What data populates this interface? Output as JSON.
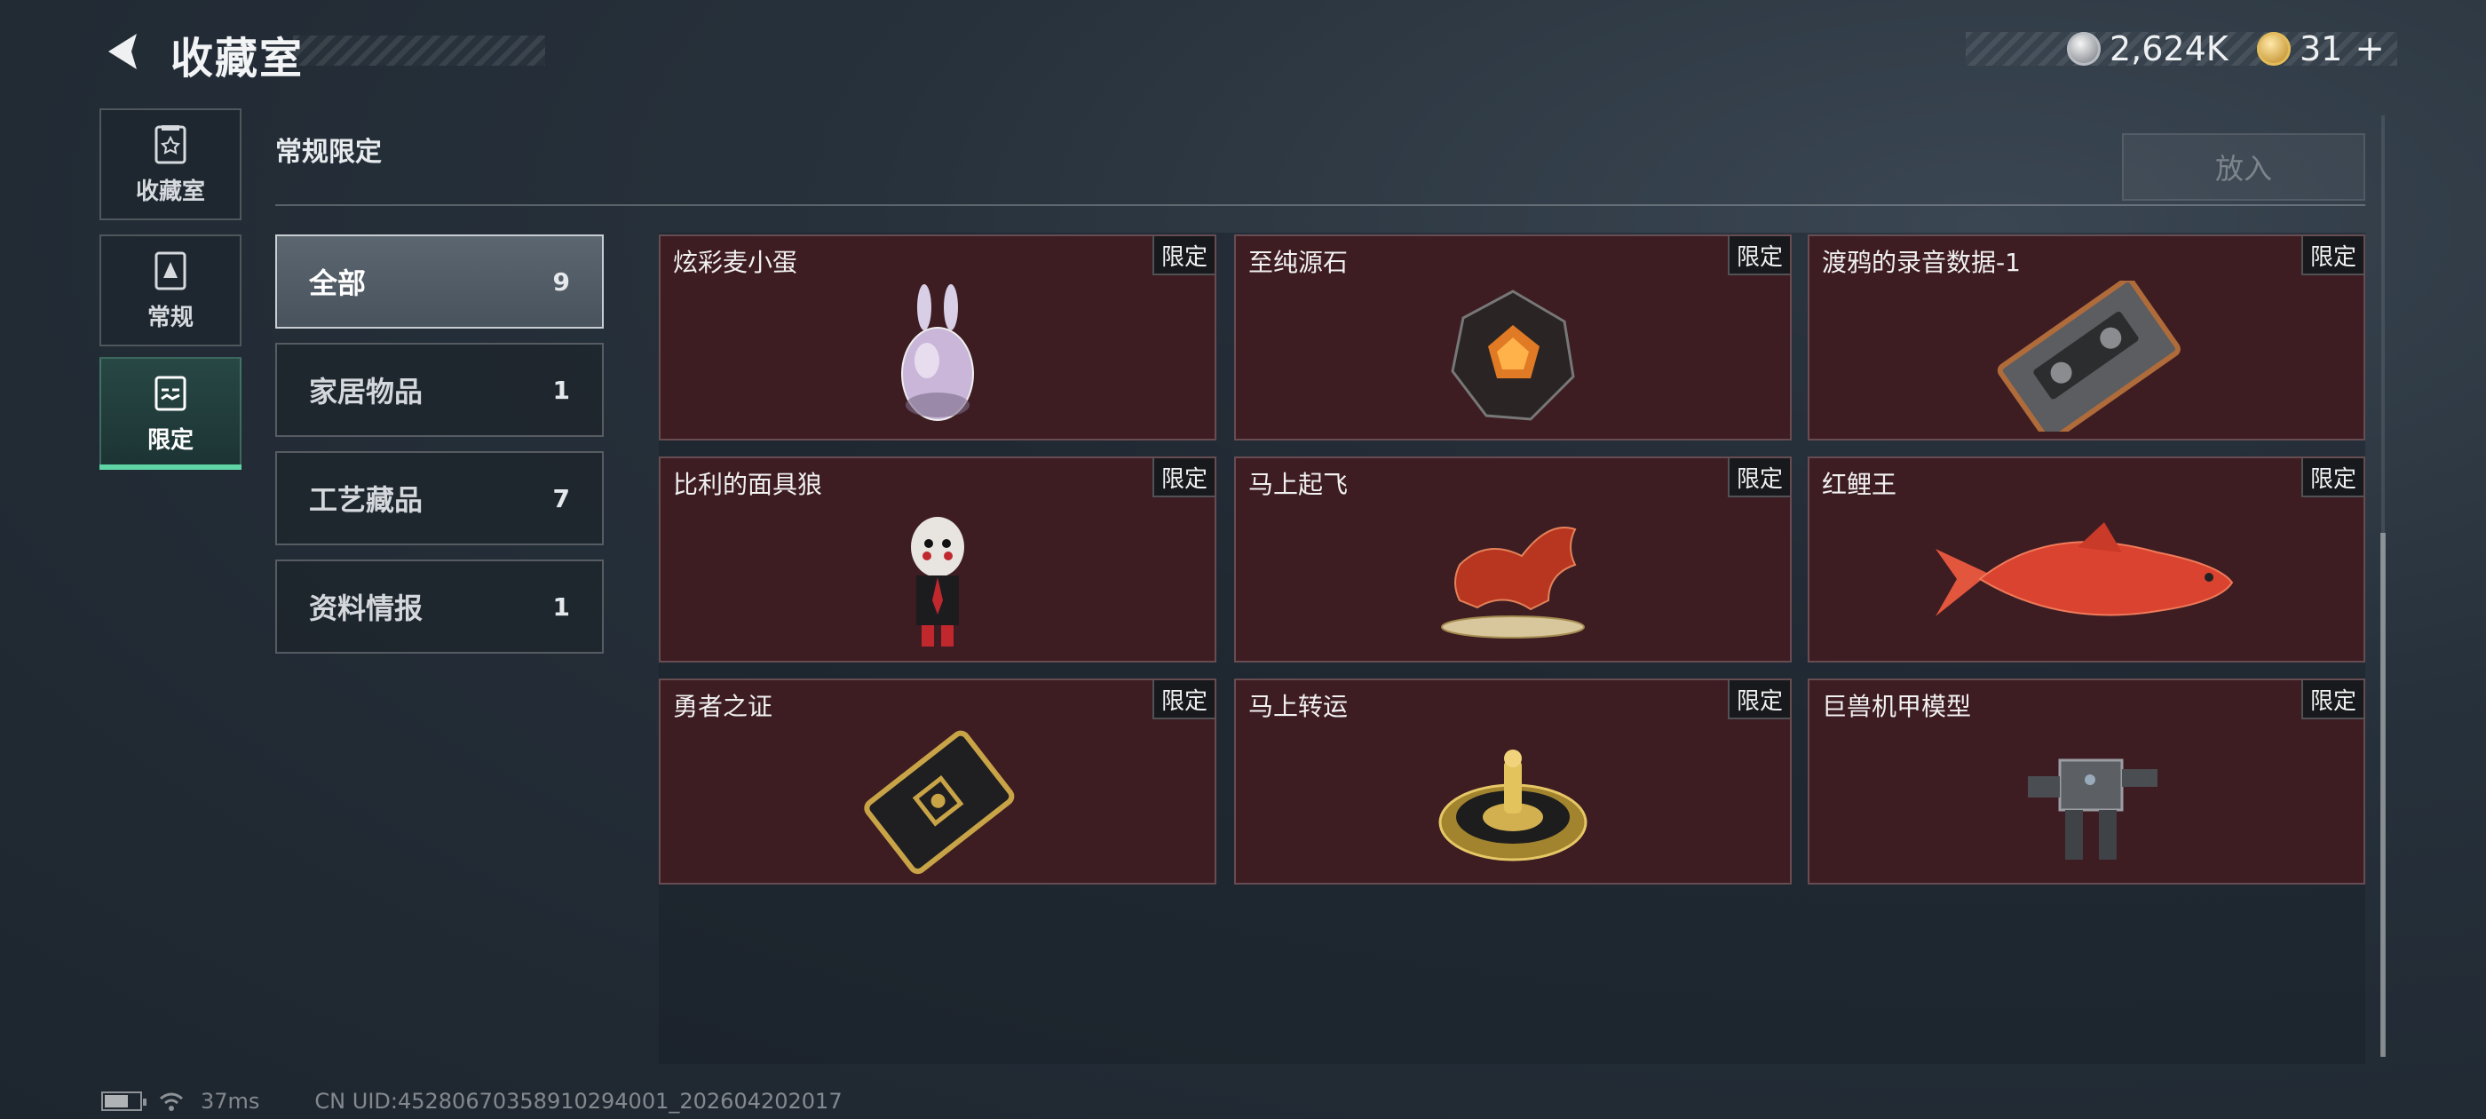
{
  "header": {
    "title": "收藏室",
    "currencies": [
      {
        "icon": "silver-coin-icon",
        "value": "2,624K"
      },
      {
        "icon": "gold-coin-icon",
        "value": "31"
      }
    ],
    "add_symbol": "+"
  },
  "nav": {
    "items": [
      {
        "label": "收藏室",
        "icon": "collection-room-icon",
        "active": false
      },
      {
        "label": "常规",
        "icon": "regular-icon",
        "active": false
      },
      {
        "label": "限定",
        "icon": "limited-icon",
        "active": true
      }
    ]
  },
  "section": {
    "title": "常规限定",
    "put_button": "放入"
  },
  "categories": [
    {
      "name": "全部",
      "count": "9",
      "active": true
    },
    {
      "name": "家居物品",
      "count": "1",
      "active": false
    },
    {
      "name": "工艺藏品",
      "count": "7",
      "active": false
    },
    {
      "name": "资料情报",
      "count": "1",
      "active": false
    }
  ],
  "items": [
    {
      "name": "炫彩麦小蛋",
      "badge": "限定",
      "art": "rabbit-egg-icon"
    },
    {
      "name": "至纯源石",
      "badge": "限定",
      "art": "gem-stone-icon"
    },
    {
      "name": "渡鸦的录音数据-1",
      "badge": "限定",
      "art": "cassette-tape-icon"
    },
    {
      "name": "比利的面具狼",
      "badge": "限定",
      "art": "puppet-figure-icon"
    },
    {
      "name": "马上起飞",
      "badge": "限定",
      "art": "horse-statue-icon"
    },
    {
      "name": "红鲤王",
      "badge": "限定",
      "art": "carp-fish-icon"
    },
    {
      "name": "勇者之证",
      "badge": "限定",
      "art": "card-token-icon"
    },
    {
      "name": "马上转运",
      "badge": "限定",
      "art": "golden-plate-icon"
    },
    {
      "name": "巨兽机甲模型",
      "badge": "限定",
      "art": "mech-model-icon"
    }
  ],
  "status": {
    "ping": "37ms",
    "uid": "CN UID:452806703589102940​01_202604202017"
  },
  "colors": {
    "card_bg": "#3d1c22",
    "active_accent": "#5fd5a6"
  }
}
